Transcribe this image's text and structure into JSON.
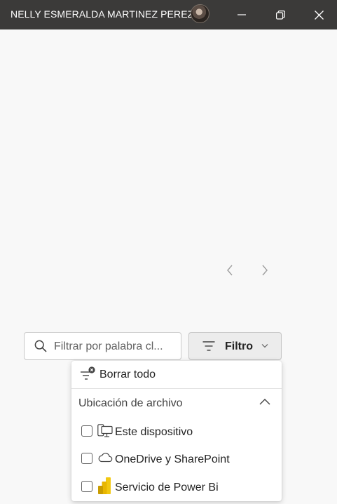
{
  "titlebar": {
    "user_name": "NELLY ESMERALDA MARTINEZ PEREZ",
    "avatar_icon": "user-avatar",
    "minimize_icon": "minimize-icon",
    "restore_icon": "restore-icon",
    "close_icon": "close-icon"
  },
  "navigation": {
    "prev_icon": "chevron-left-icon",
    "next_icon": "chevron-right-icon"
  },
  "search": {
    "placeholder": "Filtrar por palabra cl...",
    "value": "",
    "icon": "search-icon"
  },
  "filter_button": {
    "label": "Filtro",
    "icon": "filter-icon",
    "chevron": "chevron-down-icon"
  },
  "dropdown": {
    "clear_all_label": "Borrar todo",
    "section_title": "Ubicación de archivo",
    "section_expanded": true,
    "options": [
      {
        "label": "Este dispositivo",
        "checked": false,
        "icon": "device-icon"
      },
      {
        "label": "OneDrive y SharePoint",
        "checked": false,
        "icon": "cloud-icon"
      },
      {
        "label": "Servicio de Power Bi",
        "checked": false,
        "icon": "power-bi-icon"
      }
    ]
  },
  "colors": {
    "titlebar_bg": "#3b3a39",
    "page_bg": "#f8f8f8",
    "power_bi_yellow": "#f2c811"
  }
}
